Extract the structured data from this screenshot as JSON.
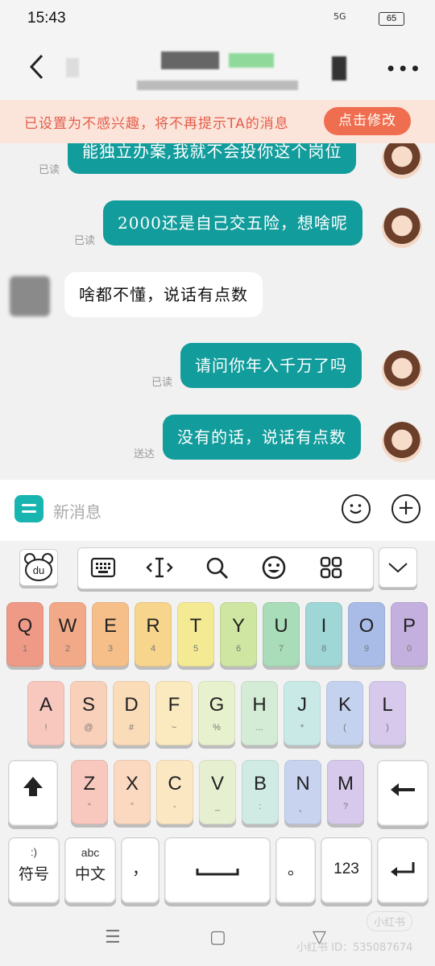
{
  "status": {
    "time": "15:43",
    "signal": "5G",
    "battery": "65"
  },
  "banner": {
    "text": "已设置为不感兴趣，将不再提示TA的消息",
    "action": "点击修改"
  },
  "messages": [
    {
      "from": "me",
      "text": "能独立办案,我就不会投你这个岗位",
      "status": "已读"
    },
    {
      "from": "me",
      "text": "2000还是自己交五险，想啥呢",
      "status": "已读"
    },
    {
      "from": "other",
      "text": "啥都不懂，说话有点数",
      "status": ""
    },
    {
      "from": "me",
      "text": "请问你年入千万了吗",
      "status": "已读"
    },
    {
      "from": "me",
      "text": "没有的话，说话有点数",
      "status": "送达"
    }
  ],
  "input": {
    "placeholder": "新消息"
  },
  "keyboard": {
    "row1": [
      {
        "k": "Q",
        "s": "1",
        "c": "#ef9a86"
      },
      {
        "k": "W",
        "s": "2",
        "c": "#f2a987"
      },
      {
        "k": "E",
        "s": "3",
        "c": "#f6bf8a"
      },
      {
        "k": "R",
        "s": "4",
        "c": "#f8d58c"
      },
      {
        "k": "T",
        "s": "5",
        "c": "#f5ea94"
      },
      {
        "k": "Y",
        "s": "6",
        "c": "#cfe6a2"
      },
      {
        "k": "U",
        "s": "7",
        "c": "#a9dcb8"
      },
      {
        "k": "I",
        "s": "8",
        "c": "#9fd7d6"
      },
      {
        "k": "O",
        "s": "9",
        "c": "#a9bce8"
      },
      {
        "k": "P",
        "s": "0",
        "c": "#c3b0de"
      }
    ],
    "row2": [
      {
        "k": "A",
        "s": "!",
        "c": "#f8c8bf"
      },
      {
        "k": "S",
        "s": "@",
        "c": "#f9d0b9"
      },
      {
        "k": "D",
        "s": "#",
        "c": "#fbdcb9"
      },
      {
        "k": "F",
        "s": "~",
        "c": "#fbeabf"
      },
      {
        "k": "G",
        "s": "%",
        "c": "#e8f1cd"
      },
      {
        "k": "H",
        "s": "...",
        "c": "#d4ecd6"
      },
      {
        "k": "J",
        "s": "*",
        "c": "#c9e9e6"
      },
      {
        "k": "K",
        "s": "(",
        "c": "#c5d2ef"
      },
      {
        "k": "L",
        "s": ")",
        "c": "#d6c9eb"
      }
    ],
    "row3": [
      {
        "k": "Z",
        "s": "“",
        "c": "#f8c8bf"
      },
      {
        "k": "X",
        "s": "”",
        "c": "#fbd8c0"
      },
      {
        "k": "C",
        "s": "-",
        "c": "#fbe7c2"
      },
      {
        "k": "V",
        "s": "_",
        "c": "#e6f0d0"
      },
      {
        "k": "B",
        "s": ":",
        "c": "#d0ebe3"
      },
      {
        "k": "N",
        "s": "、",
        "c": "#c8d4ef"
      },
      {
        "k": "M",
        "s": "?",
        "c": "#d6c9eb"
      }
    ],
    "symbols_top": ":)",
    "symbols_label": "符号",
    "chinese_top": "abc",
    "chinese_label": "中文",
    "comma": "，",
    "period": "。",
    "numbers_label": "123"
  },
  "watermark": {
    "brand": "小红书",
    "id": "小红书 ID：535087674"
  }
}
